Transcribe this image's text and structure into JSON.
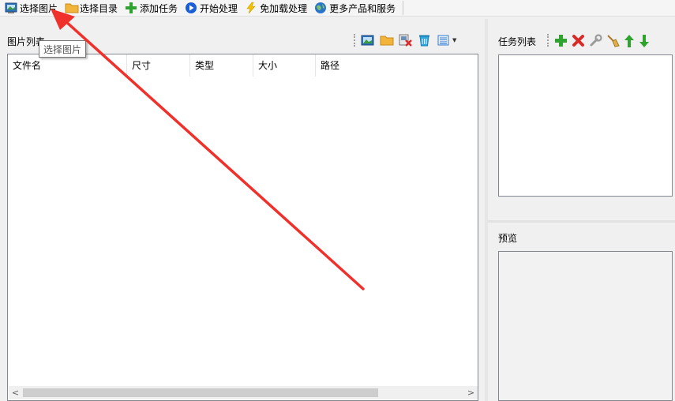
{
  "toolbar": {
    "items": [
      {
        "label": "选择图片",
        "icon": "image-icon"
      },
      {
        "label": "选择目录",
        "icon": "folder-icon"
      },
      {
        "label": "添加任务",
        "icon": "add-icon"
      },
      {
        "label": "开始处理",
        "icon": "play-icon"
      },
      {
        "label": "免加载处理",
        "icon": "lightning-icon"
      },
      {
        "label": "更多产品和服务",
        "icon": "globe-icon"
      }
    ]
  },
  "image_list": {
    "title": "图片列表",
    "tooltip": "选择图片",
    "columns": [
      "文件名",
      "尺寸",
      "类型",
      "大小",
      "路径"
    ]
  },
  "task_list": {
    "title": "任务列表"
  },
  "preview": {
    "title": "预览"
  },
  "colors": {
    "annotation_arrow": "#f0302a",
    "add": "#2ea32e",
    "delete": "#d92a2a",
    "up": "#2ea32e",
    "down": "#2ea32e",
    "play": "#1a5ed8"
  }
}
